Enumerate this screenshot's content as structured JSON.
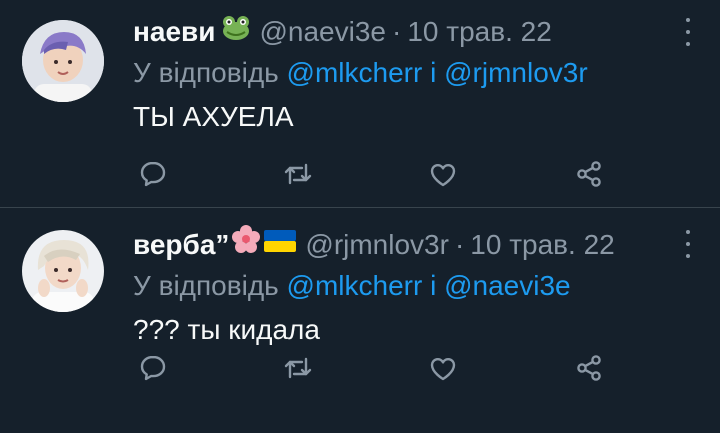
{
  "tweets": [
    {
      "name": "наеви",
      "emoji": "frog-icon",
      "handle": "@naevi3e",
      "separator": "·",
      "date": "10 трав. 22",
      "reply_prefix": "У відповідь",
      "reply_to_1": "@mlkcherr",
      "reply_conj": "і",
      "reply_to_2": "@rjmnlov3r",
      "text": "ТЫ АХУЕЛА"
    },
    {
      "name": "верба”",
      "emoji": "cherry-blossom-icon",
      "emoji2": "ukraine-flag-icon",
      "handle": "@rjmnlov3r",
      "separator": "·",
      "date": "10 трав. 22",
      "reply_prefix": "У відповідь",
      "reply_to_1": "@mlkcherr",
      "reply_conj": "і",
      "reply_to_2": "@naevi3e",
      "text": "??? ты кидала"
    }
  ],
  "colors": {
    "background": "#15202b",
    "text": "#f7f9f9",
    "muted": "#8b98a5",
    "link": "#1d9bf0",
    "divider": "#38444d"
  }
}
